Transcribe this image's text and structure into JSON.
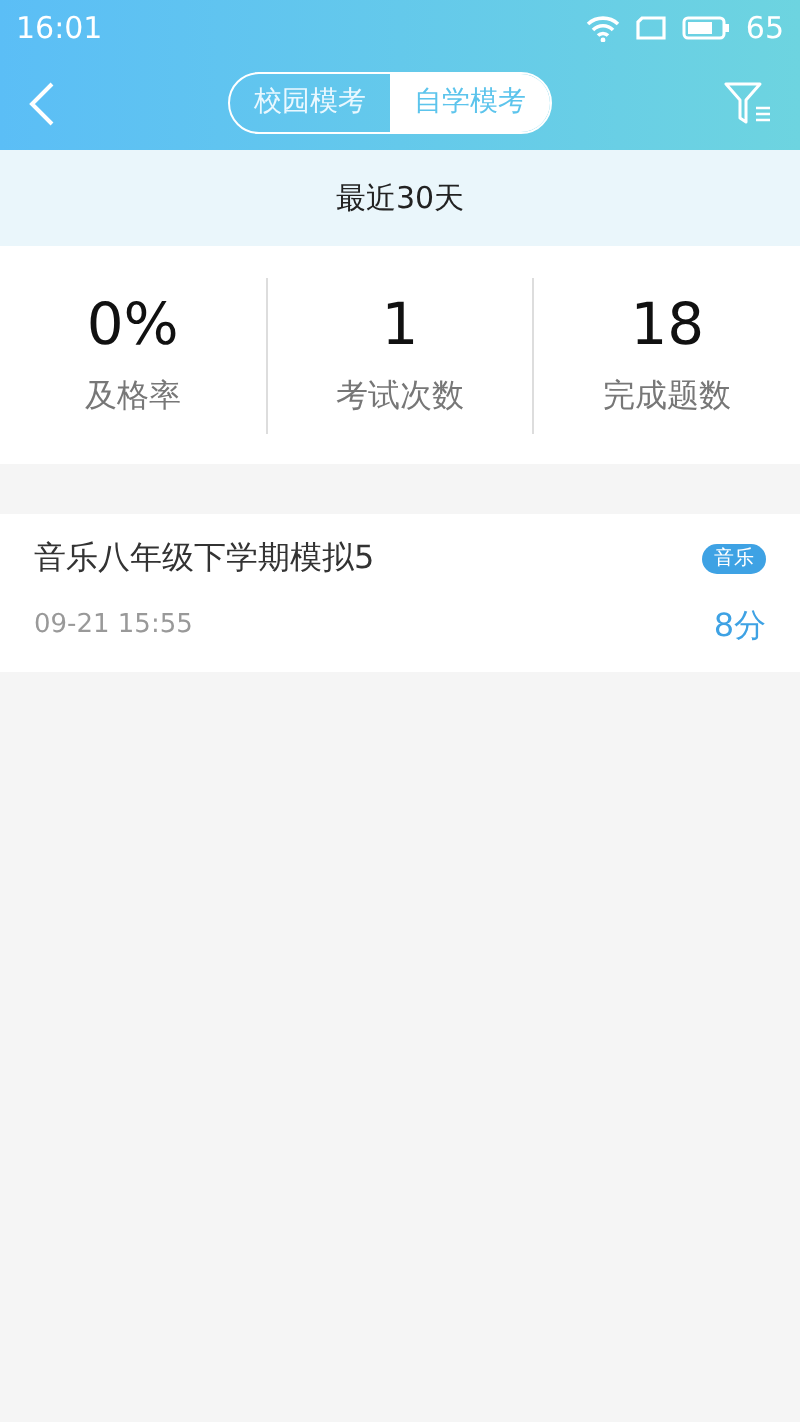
{
  "status_bar": {
    "time": "16:01",
    "battery": "65"
  },
  "segments": [
    {
      "label": "校园模考",
      "selected": false
    },
    {
      "label": "自学模考",
      "selected": true
    }
  ],
  "period": "最近30天",
  "stats": [
    {
      "value": "0%",
      "label": "及格率"
    },
    {
      "value": "1",
      "label": "考试次数"
    },
    {
      "value": "18",
      "label": "完成题数"
    }
  ],
  "records": [
    {
      "title": "音乐八年级下学期模拟5",
      "tag": "音乐",
      "time": "09-21 15:55",
      "score": "8分"
    }
  ]
}
